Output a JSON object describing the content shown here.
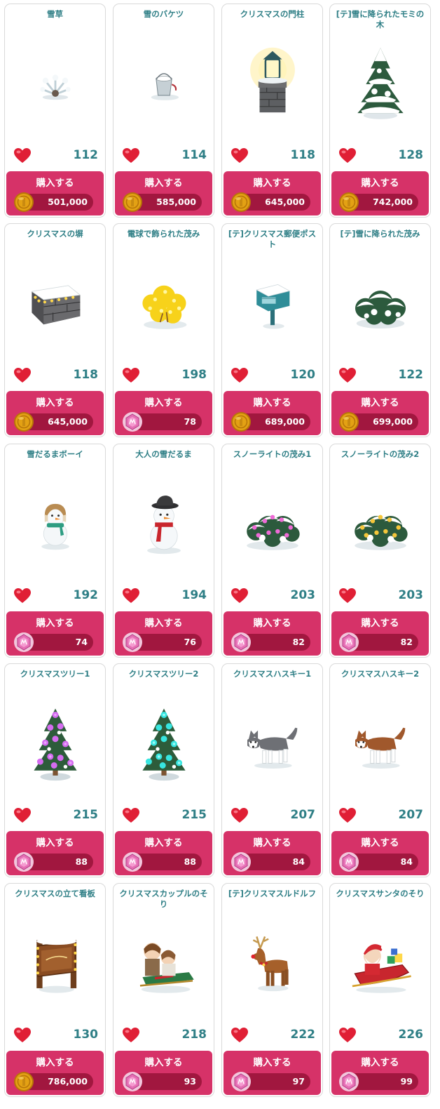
{
  "ui": {
    "buy_label": "購入する"
  },
  "colors": {
    "title_teal": "#2f7f86",
    "button_pink": "#d63268",
    "price_bar": "#a1173f",
    "heart_red": "#e01f35",
    "coin_gold": "#e3a114",
    "gem_pink": "#e56eb4"
  },
  "items": [
    {
      "name": "雪草",
      "likes": "112",
      "currency": "coin",
      "price": "501,000",
      "icon": "snow-grass"
    },
    {
      "name": "雪のバケツ",
      "likes": "114",
      "currency": "coin",
      "price": "585,000",
      "icon": "snow-bucket"
    },
    {
      "name": "クリスマスの門柱",
      "likes": "118",
      "currency": "coin",
      "price": "645,000",
      "icon": "lantern-post"
    },
    {
      "name": "[テ]雪に降られたモミの木",
      "likes": "128",
      "currency": "coin",
      "price": "742,000",
      "icon": "snowy-fir"
    },
    {
      "name": "クリスマスの塀",
      "likes": "118",
      "currency": "coin",
      "price": "645,000",
      "icon": "stone-wall"
    },
    {
      "name": "電球で飾られた茂み",
      "likes": "198",
      "currency": "gem",
      "price": "78",
      "icon": "light-bush-yellow"
    },
    {
      "name": "[テ]クリスマス郵便ポスト",
      "likes": "120",
      "currency": "coin",
      "price": "689,000",
      "icon": "mailbox"
    },
    {
      "name": "[テ]雪に降られた茂み",
      "likes": "122",
      "currency": "coin",
      "price": "699,000",
      "icon": "snowy-bush"
    },
    {
      "name": "雪だるまボーイ",
      "likes": "192",
      "currency": "gem",
      "price": "74",
      "icon": "snowman-boy"
    },
    {
      "name": "大人の雪だるま",
      "likes": "194",
      "currency": "gem",
      "price": "76",
      "icon": "snowman-adult"
    },
    {
      "name": "スノーライトの茂み1",
      "likes": "203",
      "currency": "gem",
      "price": "82",
      "icon": "snowlight-bush-pink"
    },
    {
      "name": "スノーライトの茂み2",
      "likes": "203",
      "currency": "gem",
      "price": "82",
      "icon": "snowlight-bush-gold"
    },
    {
      "name": "クリスマスツリー1",
      "likes": "215",
      "currency": "gem",
      "price": "88",
      "icon": "tree-purple"
    },
    {
      "name": "クリスマスツリー2",
      "likes": "215",
      "currency": "gem",
      "price": "88",
      "icon": "tree-cyan"
    },
    {
      "name": "クリスマスハスキー1",
      "likes": "207",
      "currency": "gem",
      "price": "84",
      "icon": "husky-gray"
    },
    {
      "name": "クリスマスハスキー2",
      "likes": "207",
      "currency": "gem",
      "price": "84",
      "icon": "husky-brown"
    },
    {
      "name": "クリスマスの立て看板",
      "likes": "130",
      "currency": "coin",
      "price": "786,000",
      "icon": "signboard"
    },
    {
      "name": "クリスマスカップルのそり",
      "likes": "218",
      "currency": "gem",
      "price": "93",
      "icon": "couple-sled"
    },
    {
      "name": "[テ]クリスマスルドルフ",
      "likes": "222",
      "currency": "gem",
      "price": "97",
      "icon": "reindeer"
    },
    {
      "name": "クリスマスサンタのそり",
      "likes": "226",
      "currency": "gem",
      "price": "99",
      "icon": "santa-sled"
    }
  ]
}
